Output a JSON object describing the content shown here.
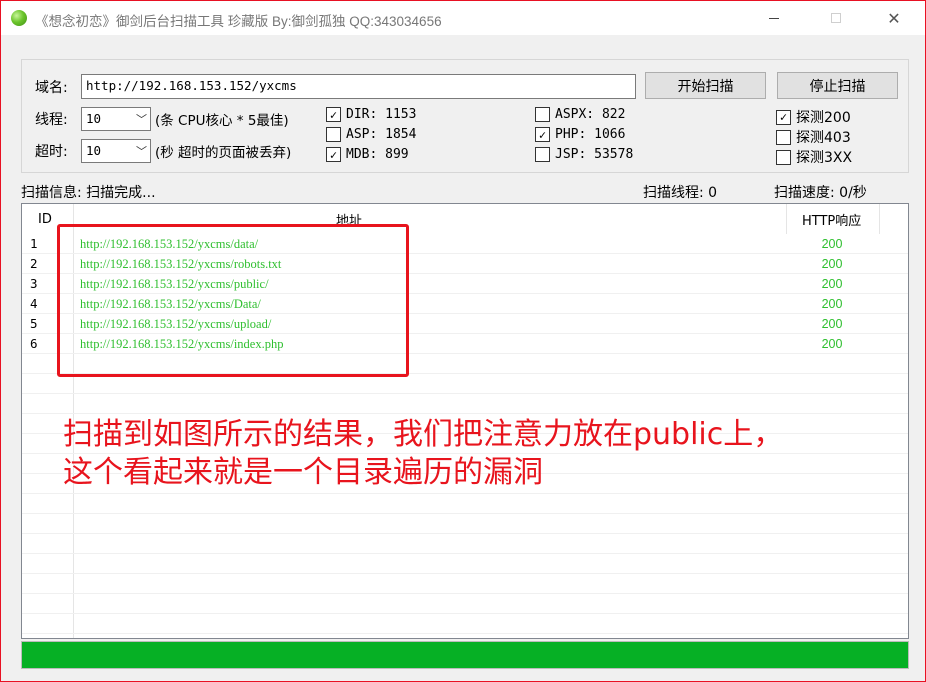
{
  "window": {
    "title": "《想念初恋》御剑后台扫描工具 珍藏版 By:御剑孤独 QQ:343034656"
  },
  "domain": {
    "label": "域名:",
    "value": "http://192.168.153.152/yxcms"
  },
  "buttons": {
    "start": "开始扫描",
    "stop": "停止扫描"
  },
  "threads": {
    "label": "线程:",
    "value": "10",
    "hint": "(条 CPU核心 * 5最佳)"
  },
  "timeout": {
    "label": "超时:",
    "value": "10",
    "hint": "(秒 超时的页面被丢弃)"
  },
  "dicts": [
    {
      "label": "DIR: 1153",
      "checked": true
    },
    {
      "label": "ASP: 1854",
      "checked": false
    },
    {
      "label": "MDB: 899",
      "checked": true
    },
    {
      "label": "ASPX: 822",
      "checked": false
    },
    {
      "label": "PHP: 1066",
      "checked": true
    },
    {
      "label": "JSP: 53578",
      "checked": false
    }
  ],
  "probes": [
    {
      "label": "探测200",
      "checked": true
    },
    {
      "label": "探测403",
      "checked": false
    },
    {
      "label": "探测3XX",
      "checked": false
    }
  ],
  "status": {
    "info": "扫描信息: 扫描完成...",
    "threads": "扫描线程: 0",
    "speed": "扫描速度: 0/秒"
  },
  "table": {
    "columns": [
      "ID",
      "地址",
      "HTTP响应"
    ],
    "rows": [
      {
        "id": "1",
        "url": "http://192.168.153.152/yxcms/data/",
        "code": "200"
      },
      {
        "id": "2",
        "url": "http://192.168.153.152/yxcms/robots.txt",
        "code": "200"
      },
      {
        "id": "3",
        "url": "http://192.168.153.152/yxcms/public/",
        "code": "200"
      },
      {
        "id": "4",
        "url": "http://192.168.153.152/yxcms/Data/",
        "code": "200"
      },
      {
        "id": "5",
        "url": "http://192.168.153.152/yxcms/upload/",
        "code": "200"
      },
      {
        "id": "6",
        "url": "http://192.168.153.152/yxcms/index.php",
        "code": "200"
      }
    ]
  },
  "annotation": {
    "line1": "扫描到如图所示的结果，我们把注意力放在public上，",
    "line2": "这个看起来就是一个目录遍历的漏洞"
  },
  "progress": {
    "percent": 100
  },
  "colors": {
    "result_green": "#2fbf2f",
    "annotation_red": "#e8141d",
    "progress_green": "#06b025"
  }
}
